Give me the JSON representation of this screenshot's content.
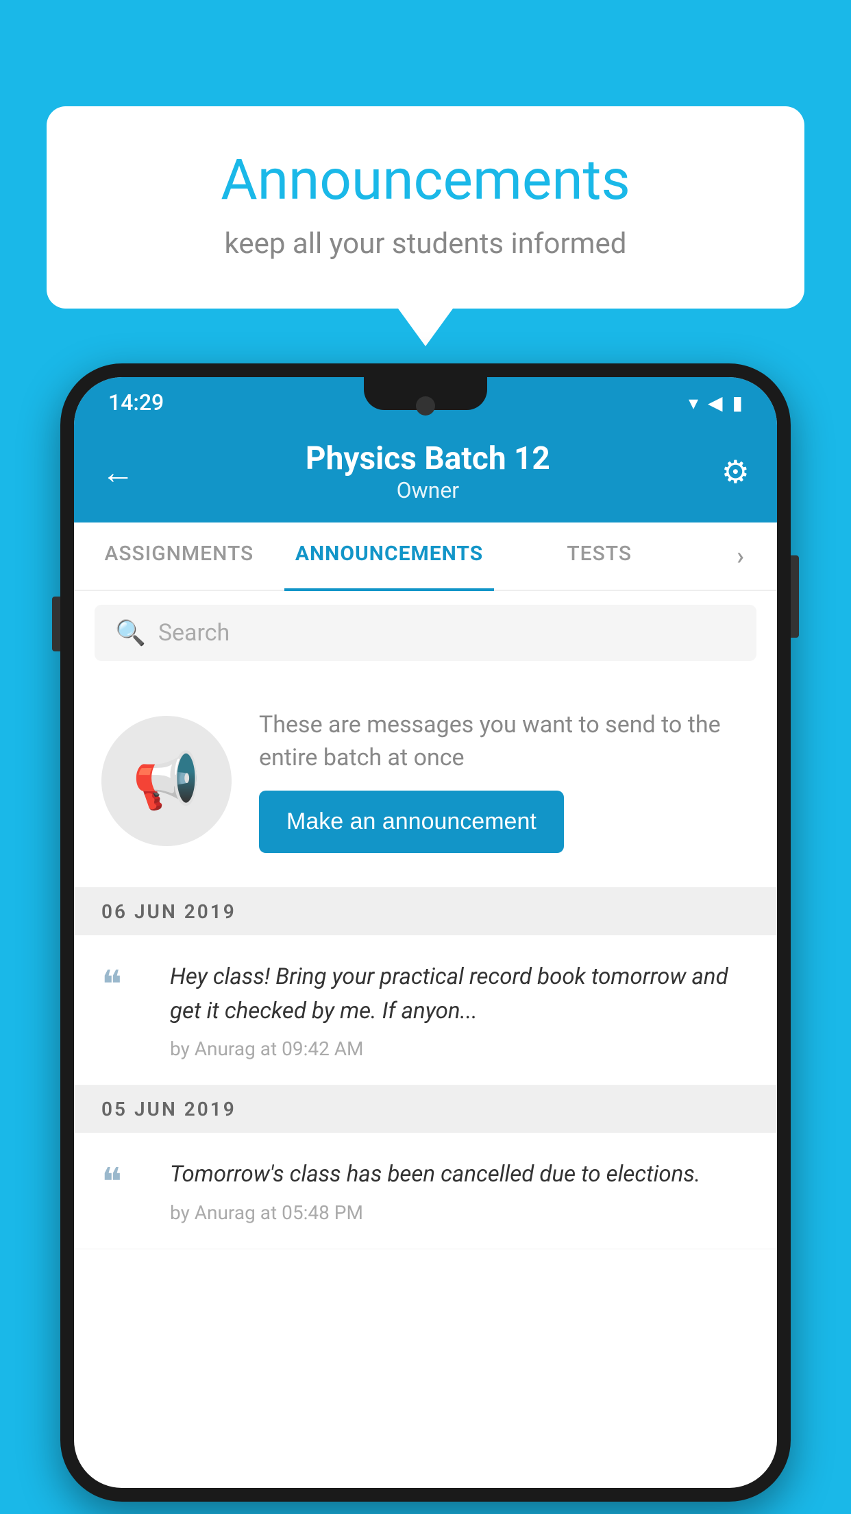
{
  "bubble": {
    "title": "Announcements",
    "subtitle": "keep all your students informed"
  },
  "status_bar": {
    "time": "14:29",
    "wifi": "▼",
    "signal": "▲",
    "battery": "▮"
  },
  "app_bar": {
    "back_icon": "←",
    "title": "Physics Batch 12",
    "subtitle": "Owner",
    "gear_icon": "⚙"
  },
  "tabs": [
    {
      "label": "ASSIGNMENTS",
      "active": false
    },
    {
      "label": "ANNOUNCEMENTS",
      "active": true
    },
    {
      "label": "TESTS",
      "active": false
    },
    {
      "label": "▸",
      "active": false
    }
  ],
  "search": {
    "placeholder": "Search"
  },
  "promo": {
    "description": "These are messages you want to send to the entire batch at once",
    "button_label": "Make an announcement"
  },
  "dates": [
    {
      "label": "06  JUN  2019",
      "announcements": [
        {
          "text": "Hey class! Bring your practical record book tomorrow and get it checked by me. If anyon...",
          "meta": "by Anurag at 09:42 AM"
        }
      ]
    },
    {
      "label": "05  JUN  2019",
      "announcements": [
        {
          "text": "Tomorrow's class has been cancelled due to elections.",
          "meta": "by Anurag at 05:48 PM"
        }
      ]
    }
  ]
}
